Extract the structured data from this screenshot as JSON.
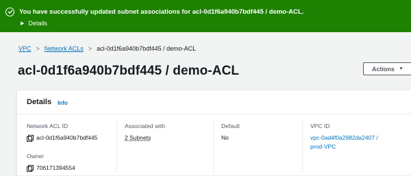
{
  "flash": {
    "message": "You have successfully updated subnet associations for acl-0d1f6a940b7bdf445 / demo-ACL.",
    "details_label": "Details",
    "color": "#1d8102"
  },
  "breadcrumb": {
    "items": [
      "VPC",
      "Network ACLs",
      "acl-0d1f6a940b7bdf445 / demo-ACL"
    ],
    "separator": ">"
  },
  "page": {
    "title": "acl-0d1f6a940b7bdf445 / demo-ACL",
    "actions_label": "Actions"
  },
  "details": {
    "title": "Details",
    "info_label": "Info",
    "network_acl_id": {
      "label": "Network ACL ID",
      "value": "acl-0d1f6a940b7bdf445"
    },
    "owner": {
      "label": "Owner",
      "value": "706171394554"
    },
    "associated_with": {
      "label": "Associated with",
      "value": "2 Subnets"
    },
    "default": {
      "label": "Default",
      "value": "No"
    },
    "vpc_id": {
      "label": "VPC ID",
      "value_line1": "vpc-0ad4f0a2982da2407 /",
      "value_line2": "prod-VPC"
    }
  }
}
